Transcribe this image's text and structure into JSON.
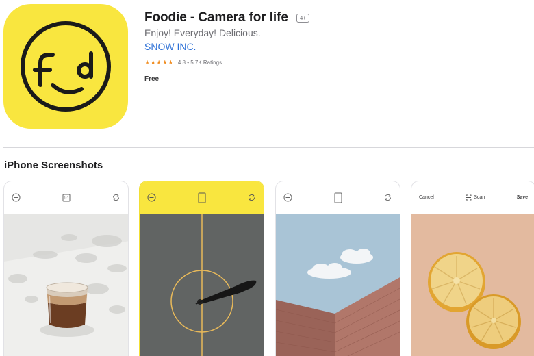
{
  "app": {
    "title": "Foodie - Camera for life",
    "age_rating": "4+",
    "subtitle": "Enjoy! Everyday! Delicious.",
    "developer": "SNOW INC.",
    "stars": "★★★★★",
    "rating": "4.8 • 5.7K Ratings",
    "price": "Free",
    "icon": "foodie-face-logo-icon",
    "brand_color": "#f9e63f"
  },
  "screenshots_section": {
    "title": "iPhone Screenshots"
  },
  "screenshots": [
    {
      "toolbar": [
        "circle-icon",
        "frame-icon",
        "rotate-icon"
      ],
      "photo": "latte-glass-photo"
    },
    {
      "toolbar": [
        "circle-icon",
        "frame-icon",
        "rotate-icon"
      ],
      "photo": "court-shadow-photo",
      "bar_color": "#f9e63f"
    },
    {
      "toolbar": [
        "circle-icon",
        "frame-icon",
        "rotate-icon"
      ],
      "photo": "brick-wall-sky-photo"
    },
    {
      "toolbar_labels": {
        "cancel": "Cancel",
        "scan": "Scan",
        "save": "Save"
      },
      "scan_icon": "scan-icon",
      "photo": "lemon-halves-photo"
    }
  ]
}
